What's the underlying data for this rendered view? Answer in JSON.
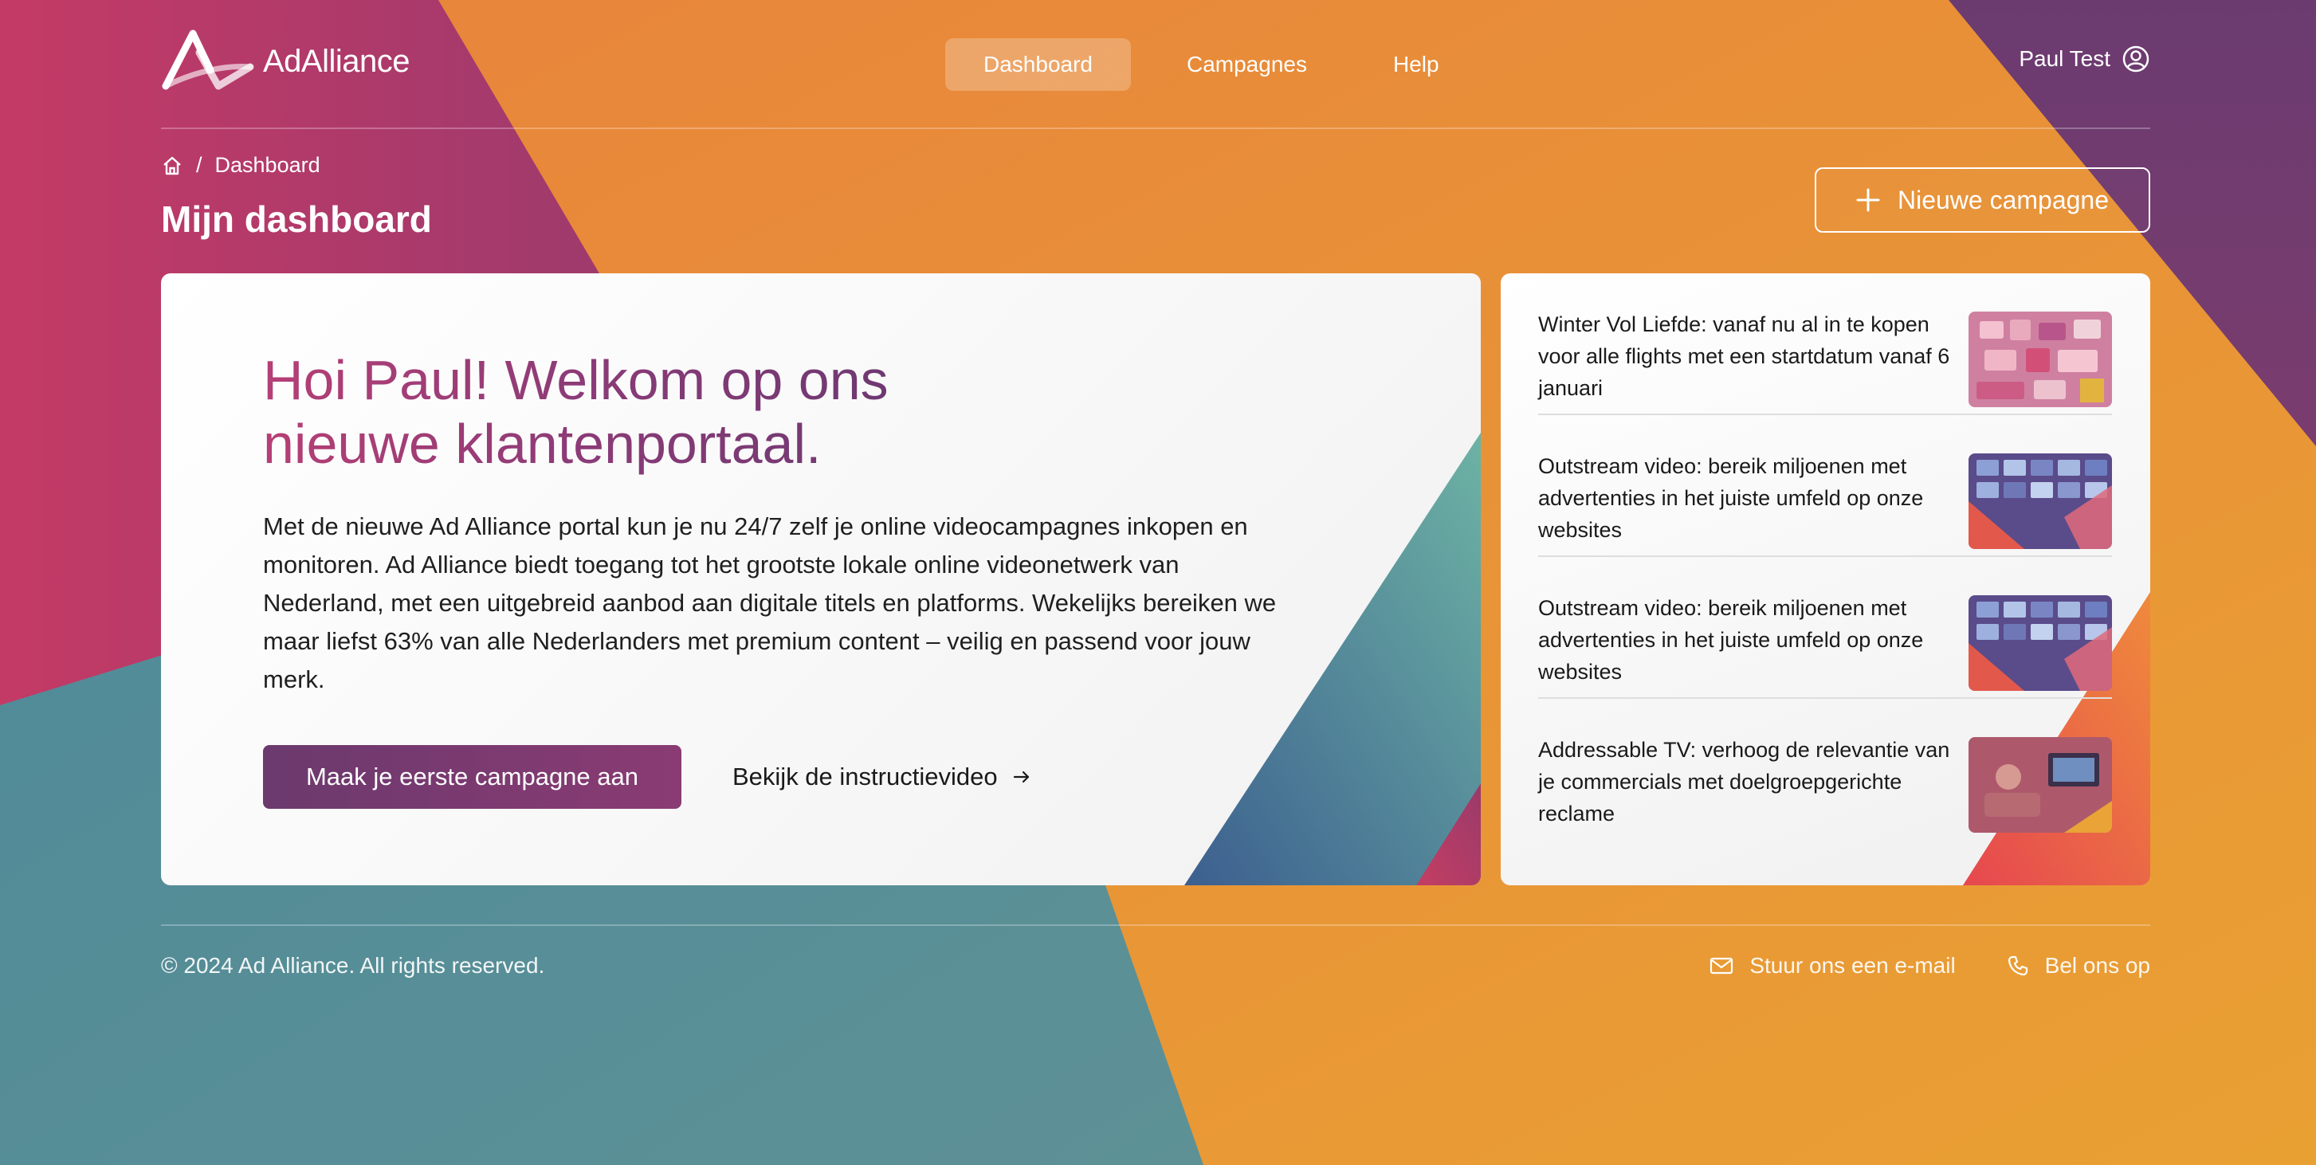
{
  "brand": {
    "logo_text": "AdAlliance"
  },
  "nav": {
    "items": [
      {
        "label": "Dashboard",
        "active": true
      },
      {
        "label": "Campagnes",
        "active": false
      },
      {
        "label": "Help",
        "active": false
      }
    ]
  },
  "user": {
    "name": "Paul Test",
    "icon": "user-circle-icon"
  },
  "breadcrumb": {
    "home_icon": "home-icon",
    "separator": "/",
    "current": "Dashboard"
  },
  "page": {
    "title": "Mijn dashboard",
    "new_campaign_label": "Nieuwe campagne"
  },
  "welcome": {
    "title": "Hoi Paul! Welkom op ons nieuwe klantenportaal.",
    "body": "Met de nieuwe Ad Alliance portal kun je nu 24/7 zelf je online videocampagnes inkopen en monitoren. Ad Alliance biedt toegang tot het grootste lokale online videonetwerk van Nederland, met een uitgebreid aanbod aan digitale titels en platforms. Wekelijks bereiken we maar liefst 63% van alle Nederlanders met premium content – veilig en passend voor jouw merk.",
    "primary_label": "Maak je eerste campagne aan",
    "secondary_label": "Bekijk de instructievideo"
  },
  "news": [
    {
      "title": "Winter Vol Liefde: vanaf nu al in te kopen voor alle flights met een startdatum vanaf 6 januari",
      "thumb": "winter-thumbnail"
    },
    {
      "title": "Outstream video: bereik miljoenen met advertenties in het juiste umfeld op onze websites",
      "thumb": "outstream-thumbnail"
    },
    {
      "title": "Outstream video: bereik miljoenen met advertenties in het juiste umfeld op onze websites",
      "thumb": "outstream-thumbnail"
    },
    {
      "title": "Addressable TV: verhoog de relevantie van je commercials met doelgroepgerichte reclame",
      "thumb": "addressable-tv-thumbnail"
    }
  ],
  "footer": {
    "copyright": "© 2024 Ad Alliance. All rights reserved.",
    "email_label": "Stuur ons een e-mail",
    "phone_label": "Bel ons op"
  },
  "colors": {
    "orange": "#e8903a",
    "magenta": "#b8406e",
    "purple": "#5f3a70",
    "teal": "#5a8c92",
    "title_gradient_start": "#b63f76",
    "title_gradient_end": "#5f376f"
  }
}
